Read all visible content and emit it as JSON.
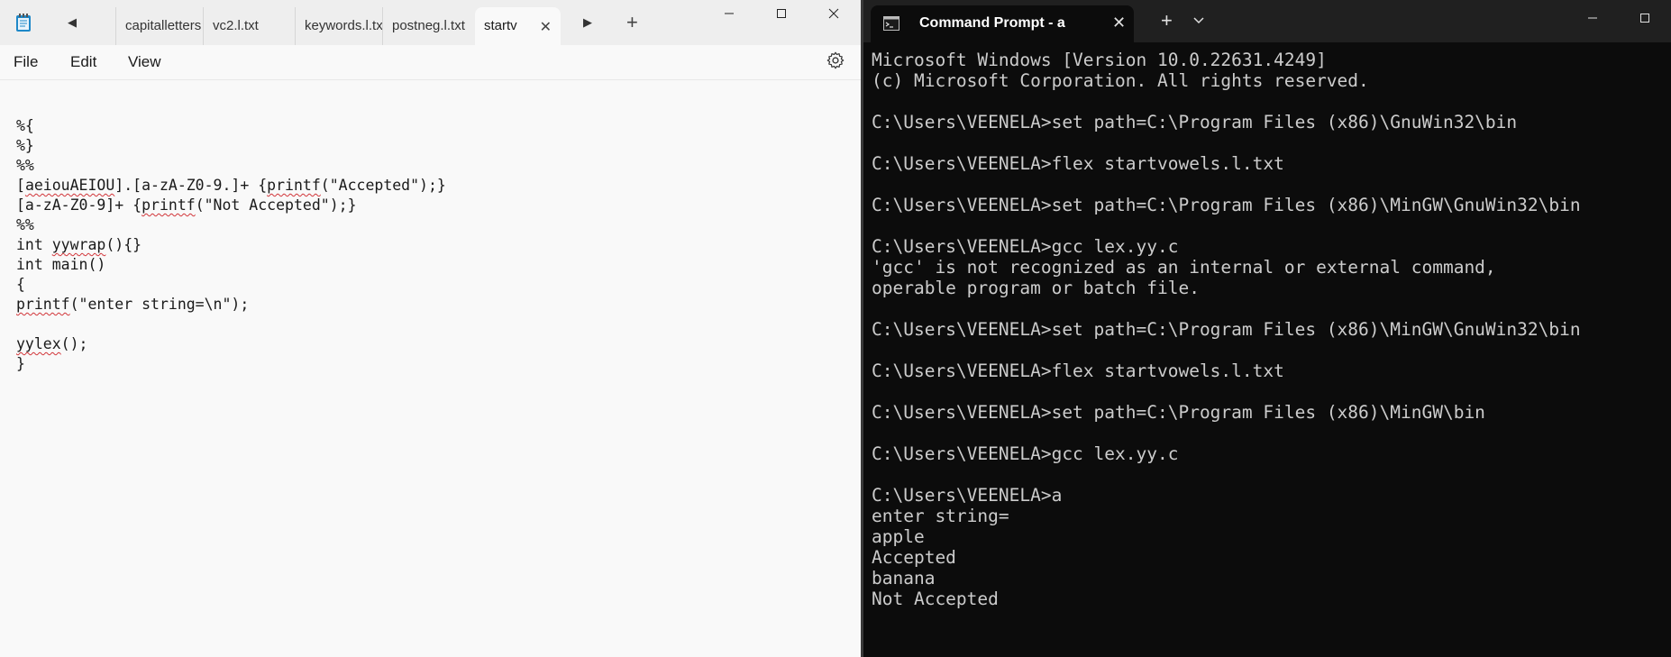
{
  "notepad": {
    "tabs": [
      "capitalletters",
      "vc2.l.txt",
      "keywords.l.txt",
      "postneg.l.txt"
    ],
    "active_tab": "startv",
    "new_tab_label": "+",
    "menu": [
      "File",
      "Edit",
      "View"
    ],
    "icons": {
      "app": "notepad-icon",
      "scroll_left": "chevron-left-icon",
      "scroll_right": "chevron-right-icon",
      "close": "close-icon",
      "minimize": "minimize-icon",
      "maximize": "maximize-icon",
      "settings": "gear-icon"
    },
    "code_lines": [
      "%{",
      "%}",
      "%%",
      "[aeiouAEIOU].[a-zA-Z0-9.]+ {printf(\"Accepted\");}",
      "[a-zA-Z0-9]+ {printf(\"Not Accepted\");}",
      "%%",
      "int yywrap(){}",
      "int main()",
      "{",
      "printf(\"enter string=\\n\");",
      "",
      "yylex();",
      "}"
    ]
  },
  "terminal": {
    "tab_title": "Command Prompt - a",
    "new_tab_label": "+",
    "icons": {
      "tab": "command-prompt-icon",
      "close": "close-icon",
      "dropdown": "chevron-down-icon",
      "minimize": "minimize-icon",
      "maximize": "maximize-icon"
    },
    "lines": [
      "Microsoft Windows [Version 10.0.22631.4249]",
      "(c) Microsoft Corporation. All rights reserved.",
      "",
      "C:\\Users\\VEENELA>set path=C:\\Program Files (x86)\\GnuWin32\\bin",
      "",
      "C:\\Users\\VEENELA>flex startvowels.l.txt",
      "",
      "C:\\Users\\VEENELA>set path=C:\\Program Files (x86)\\MinGW\\GnuWin32\\bin",
      "",
      "C:\\Users\\VEENELA>gcc lex.yy.c",
      "'gcc' is not recognized as an internal or external command,",
      "operable program or batch file.",
      "",
      "C:\\Users\\VEENELA>set path=C:\\Program Files (x86)\\MinGW\\GnuWin32\\bin",
      "",
      "C:\\Users\\VEENELA>flex startvowels.l.txt",
      "",
      "C:\\Users\\VEENELA>set path=C:\\Program Files (x86)\\MinGW\\bin",
      "",
      "C:\\Users\\VEENELA>gcc lex.yy.c",
      "",
      "C:\\Users\\VEENELA>a",
      "enter string=",
      "apple",
      "Accepted",
      "banana",
      "Not Accepted"
    ]
  },
  "colors": {
    "notepad_bg": "#f9f9f9",
    "notepad_titlebar": "#eeeeee",
    "terminal_bg": "#0c0c0c",
    "terminal_titlebar": "#202020",
    "terminal_text": "#cccccc",
    "spellcheck": "#d13438"
  }
}
